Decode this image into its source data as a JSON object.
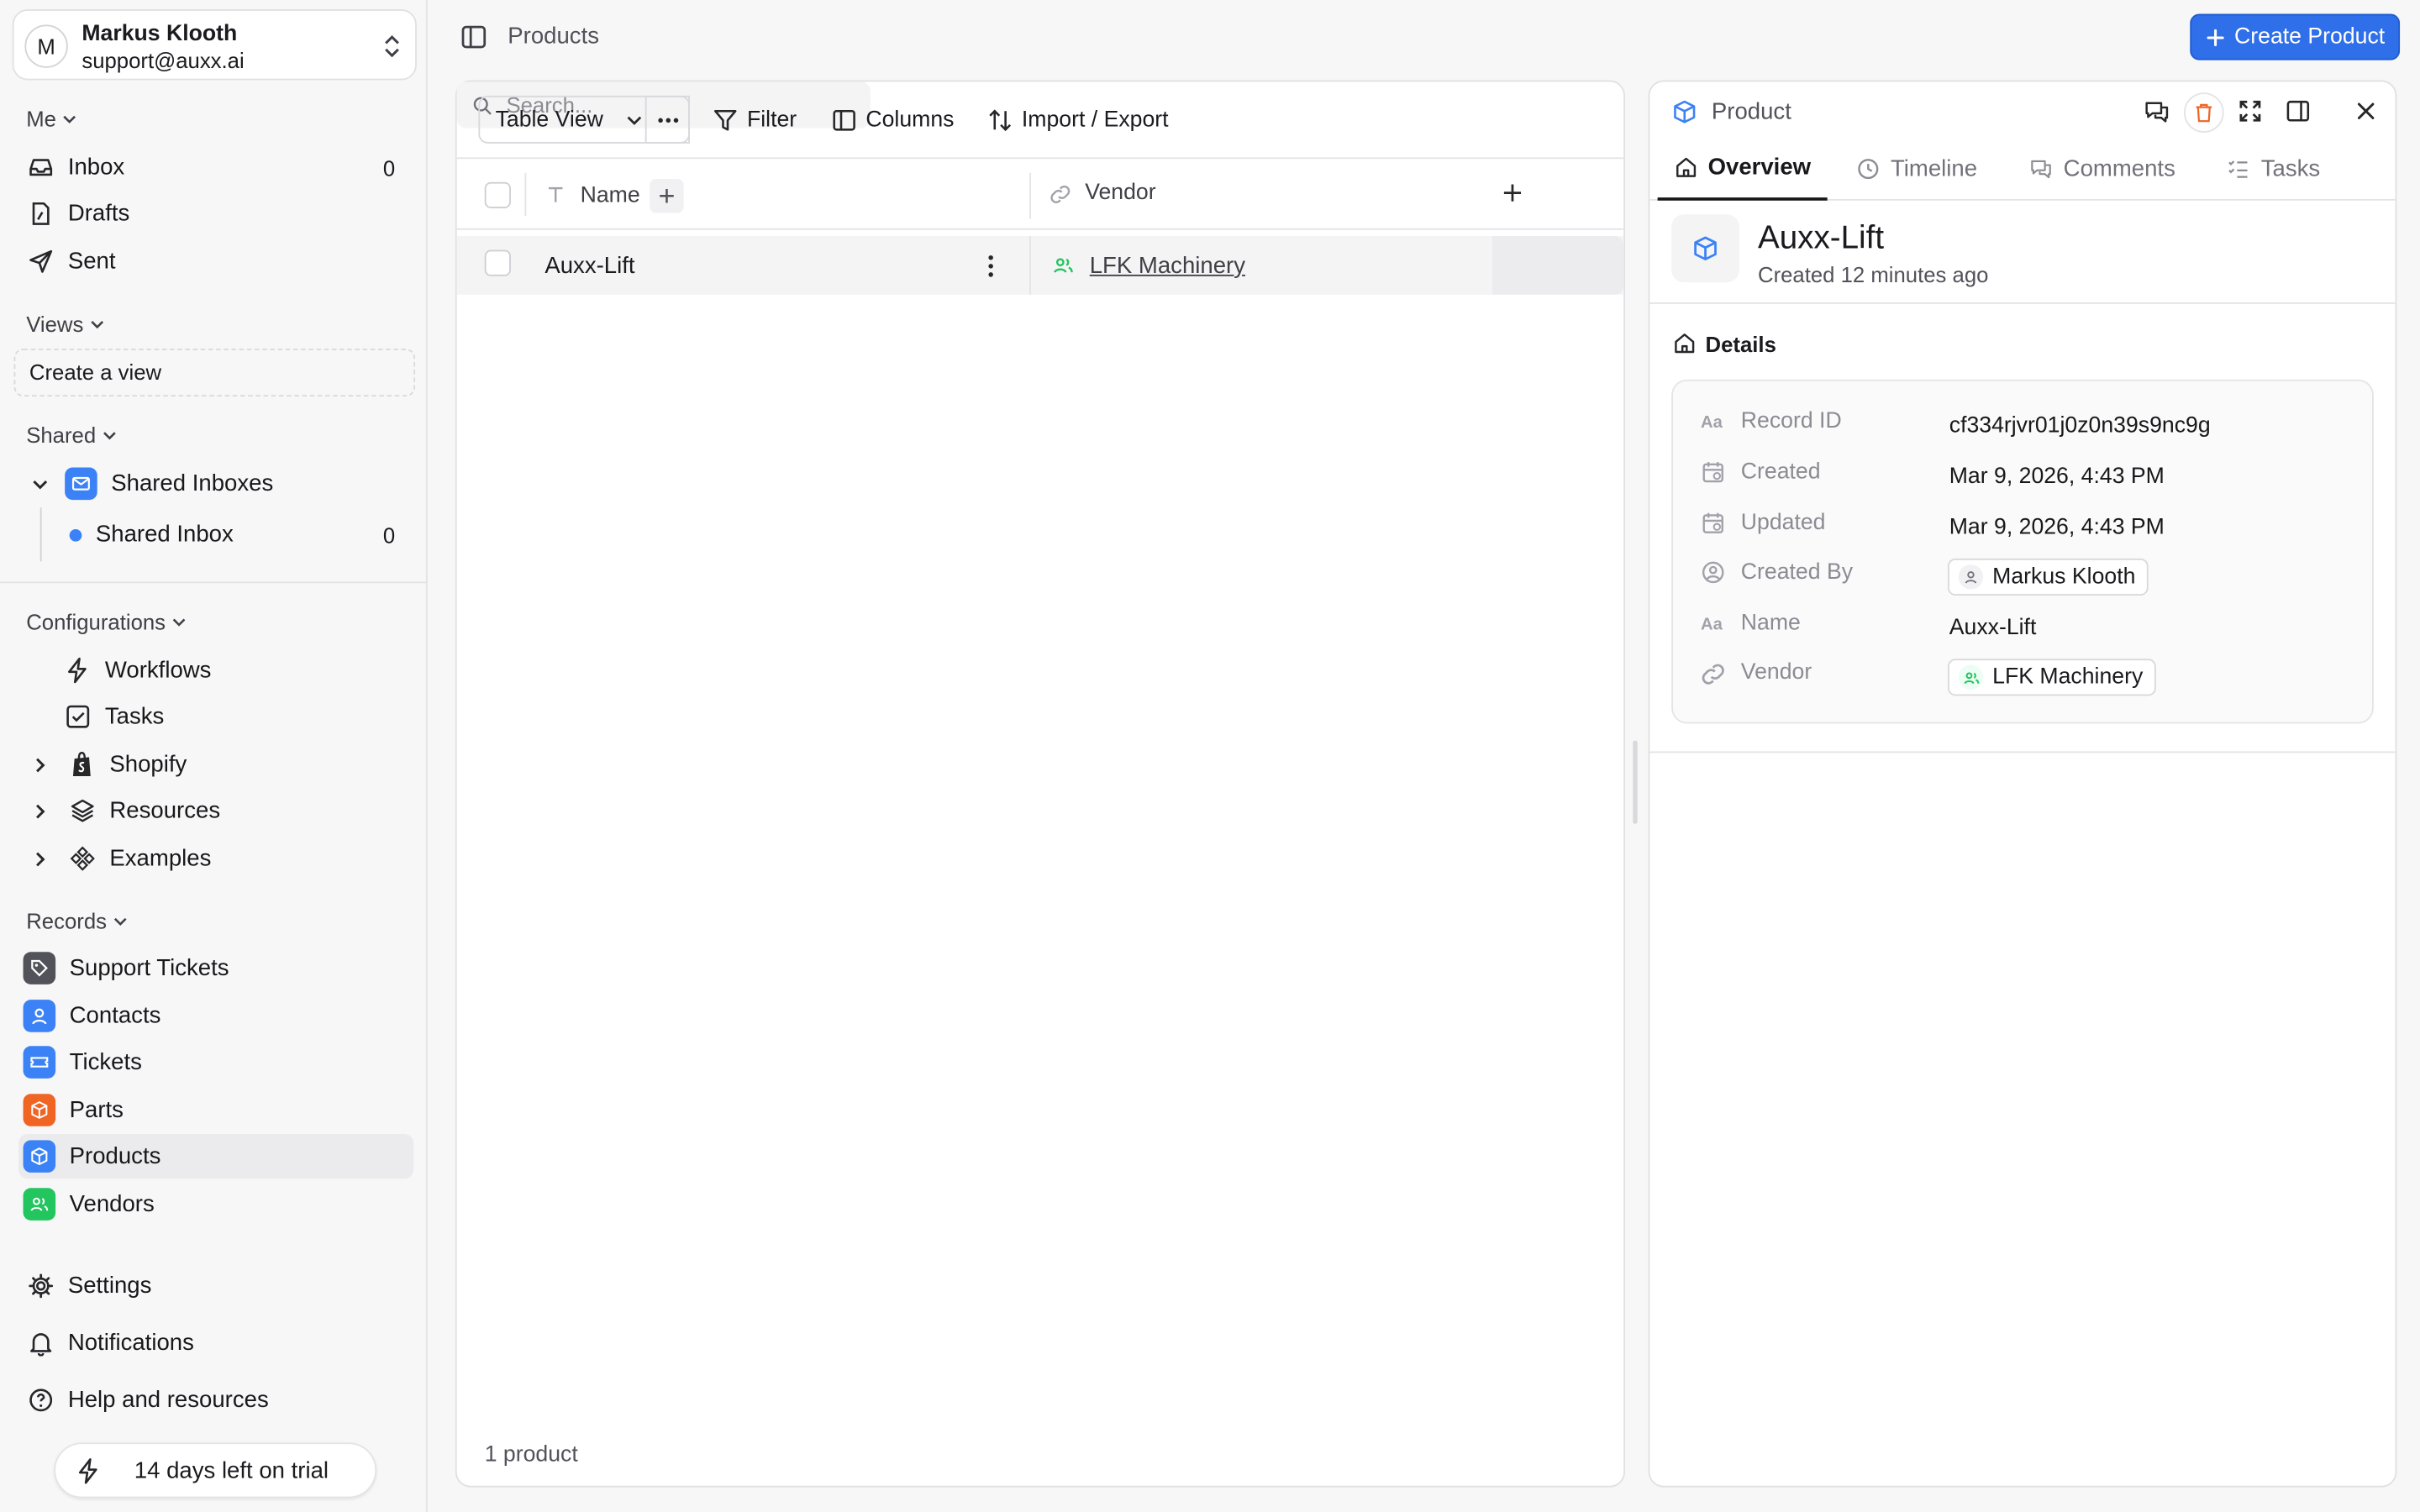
{
  "account": {
    "initial": "M",
    "name": "Markus Klooth",
    "email": "support@auxx.ai"
  },
  "sidebar": {
    "me_label": "Me",
    "inbox": {
      "label": "Inbox",
      "count": "0"
    },
    "drafts": {
      "label": "Drafts"
    },
    "sent": {
      "label": "Sent"
    },
    "views_label": "Views",
    "create_view": "Create a view",
    "shared_label": "Shared",
    "shared_inboxes": "Shared Inboxes",
    "shared_inbox": {
      "label": "Shared Inbox",
      "count": "0"
    },
    "configurations_label": "Configurations",
    "workflows": "Workflows",
    "tasks": "Tasks",
    "shopify": "Shopify",
    "resources": "Resources",
    "examples": "Examples",
    "records_label": "Records",
    "records": [
      {
        "label": "Support Tickets",
        "color": "#52525b"
      },
      {
        "label": "Contacts",
        "color": "#3b82f6"
      },
      {
        "label": "Tickets",
        "color": "#3b82f6"
      },
      {
        "label": "Parts",
        "color": "#f06424"
      },
      {
        "label": "Products",
        "color": "#3b82f6"
      },
      {
        "label": "Vendors",
        "color": "#22c55e"
      }
    ],
    "settings": "Settings",
    "notifications": "Notifications",
    "help": "Help and resources",
    "trial": "14 days left on trial"
  },
  "header": {
    "breadcrumb": "Products",
    "create_button": "Create Product"
  },
  "table": {
    "view_label": "Table View",
    "filter": "Filter",
    "columns": "Columns",
    "import_export": "Import / Export",
    "search_placeholder": "Search...",
    "col_name": "Name",
    "col_vendor": "Vendor",
    "rows": [
      {
        "name": "Auxx-Lift",
        "vendor": "LFK Machinery"
      }
    ],
    "footer": "1 product"
  },
  "detail": {
    "type_label": "Product",
    "tabs": [
      "Overview",
      "Timeline",
      "Comments",
      "Tasks"
    ],
    "title": "Auxx-Lift",
    "subtitle": "Created 12 minutes ago",
    "section": "Details",
    "fields": {
      "record_id": {
        "label": "Record ID",
        "value": "cf334rjvr01j0z0n39s9nc9g"
      },
      "created": {
        "label": "Created",
        "value": "Mar 9, 2026, 4:43 PM"
      },
      "updated": {
        "label": "Updated",
        "value": "Mar 9, 2026, 4:43 PM"
      },
      "created_by": {
        "label": "Created By",
        "value": "Markus Klooth"
      },
      "name": {
        "label": "Name",
        "value": "Auxx-Lift"
      },
      "vendor": {
        "label": "Vendor",
        "value": "LFK Machinery"
      }
    }
  },
  "colors": {
    "accent": "#2f6fe9",
    "vendor_green": "#22c55e",
    "parts_orange": "#f06424"
  }
}
